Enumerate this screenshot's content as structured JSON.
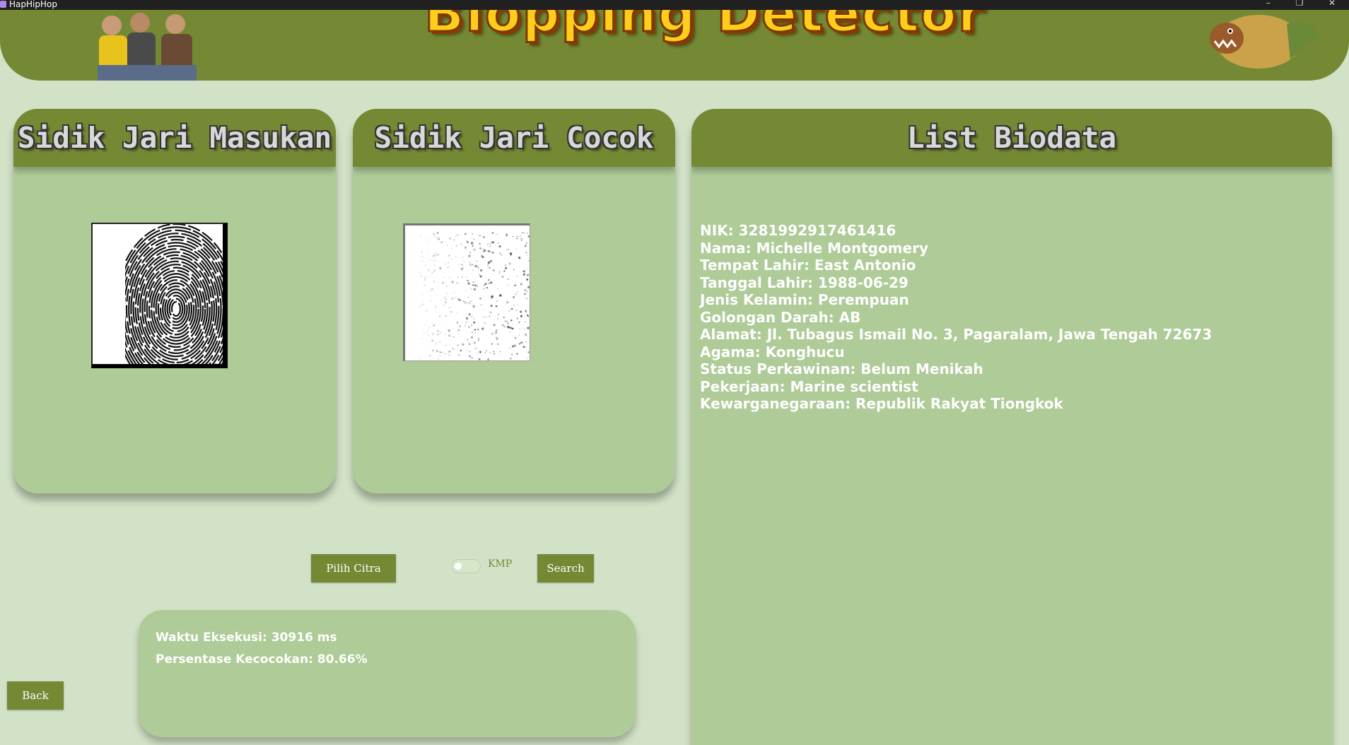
{
  "window": {
    "title": "HapHipHop"
  },
  "header": {
    "logo_text": "Blopping Detector"
  },
  "panels": {
    "input": {
      "title": "Sidik Jari Masukan"
    },
    "match": {
      "title": "Sidik Jari Cocok"
    },
    "biodata": {
      "title": "List Biodata",
      "lines": [
        "NIK: 3281992917461416",
        "Nama: Michelle Montgomery",
        "Tempat Lahir: East Antonio",
        "Tanggal Lahir: 1988-06-29",
        "Jenis Kelamin: Perempuan",
        "Golongan Darah: AB",
        "Alamat: Jl. Tubagus Ismail No. 3, Pagaralam, Jawa Tengah 72673",
        "Agama: Konghucu",
        "Status Perkawinan: Belum Menikah",
        "Pekerjaan: Marine scientist",
        "Kewarganegaraan: Republik Rakyat Tiongkok"
      ]
    }
  },
  "controls": {
    "pick_label": "Pilih Citra",
    "toggle_label": "KMP",
    "toggle_on": false,
    "search_label": "Search",
    "back_label": "Back"
  },
  "results": {
    "time": "Waktu Eksekusi: 30916 ms",
    "match": "Persentase Kecocokan: 80.66%"
  },
  "colors": {
    "accent": "#758935",
    "panel": "#aecb98",
    "background": "#d2e2c6",
    "logo": "#ffcd1c"
  }
}
